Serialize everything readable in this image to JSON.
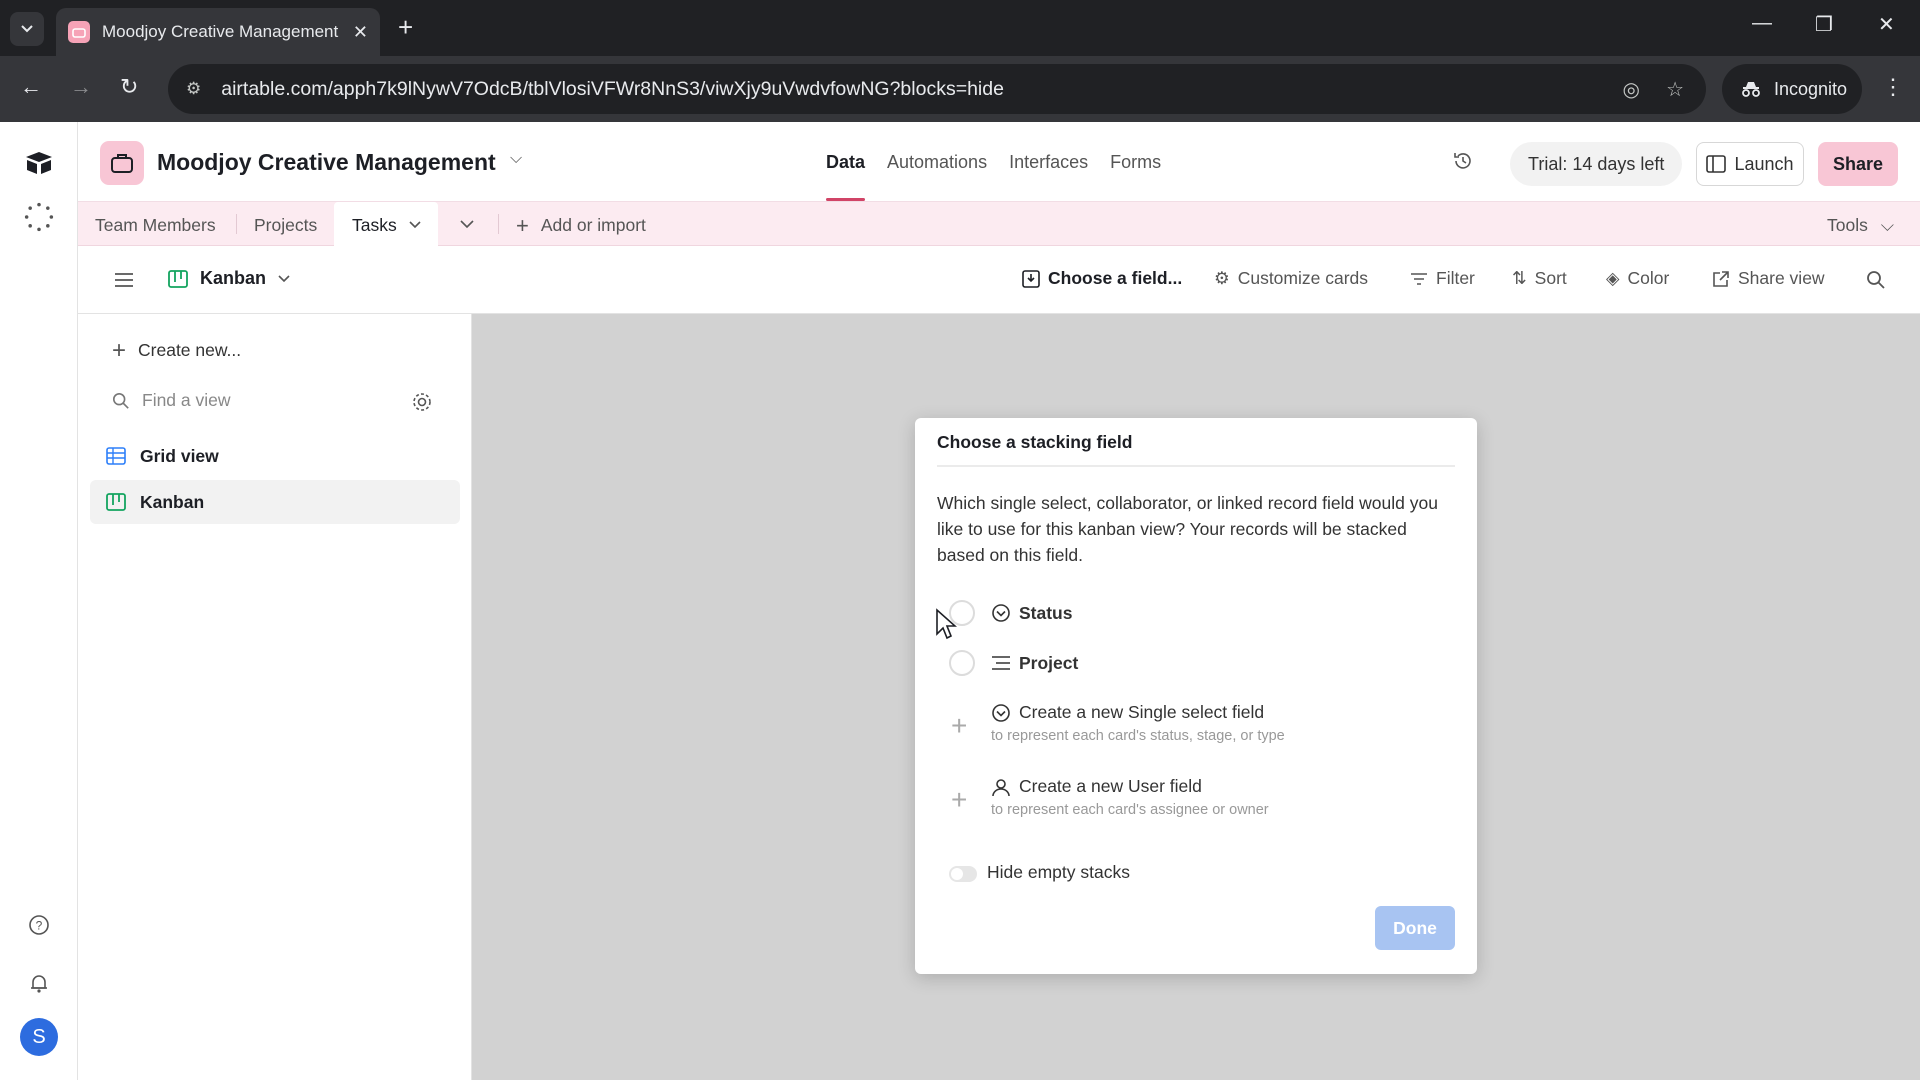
{
  "browser": {
    "tab_title": "Moodjoy Creative Management",
    "url": "airtable.com/apph7k9lNywV7OdcB/tblVlosiVFWr8NnS3/viwXjy9uVwdvfowNG?blocks=hide",
    "incognito_label": "Incognito"
  },
  "header": {
    "base_name": "Moodjoy Creative Management",
    "nav_tabs": [
      "Data",
      "Automations",
      "Interfaces",
      "Forms"
    ],
    "active_tab": "Data",
    "trial_label": "Trial: 14 days left",
    "launch_label": "Launch",
    "share_label": "Share"
  },
  "tables": {
    "items": [
      "Team Members",
      "Projects",
      "Tasks"
    ],
    "active": "Tasks",
    "add_label": "Add or import",
    "tools_label": "Tools"
  },
  "view_bar": {
    "view_name": "Kanban",
    "choose_field_label": "Choose a field...",
    "customize_label": "Customize cards",
    "filter_label": "Filter",
    "sort_label": "Sort",
    "color_label": "Color",
    "share_view_label": "Share view"
  },
  "sidebar": {
    "create_label": "Create new...",
    "find_placeholder": "Find a view",
    "views": [
      {
        "label": "Grid view",
        "icon": "grid-icon"
      },
      {
        "label": "Kanban",
        "icon": "kanban-icon",
        "selected": true
      }
    ]
  },
  "modal": {
    "title": "Choose a stacking field",
    "description": "Which single select, collaborator, or linked record field would you like to use for this kanban view? Your records will be stacked based on this field.",
    "options": [
      {
        "label": "Status",
        "icon": "single-select-icon"
      },
      {
        "label": "Project",
        "icon": "linked-record-icon"
      }
    ],
    "create_options": [
      {
        "label": "Create a new Single select field",
        "sub": "to represent each card's status, stage, or type",
        "icon": "single-select-icon"
      },
      {
        "label": "Create a new User field",
        "sub": "to represent each card's assignee or owner",
        "icon": "user-icon"
      }
    ],
    "toggle_label": "Hide empty stacks",
    "done_label": "Done"
  },
  "rail": {
    "avatar_initial": "S"
  },
  "colors": {
    "accent": "#d14467",
    "brand_pink": "#f8c6d5",
    "done_button": "#a8c4f2"
  }
}
